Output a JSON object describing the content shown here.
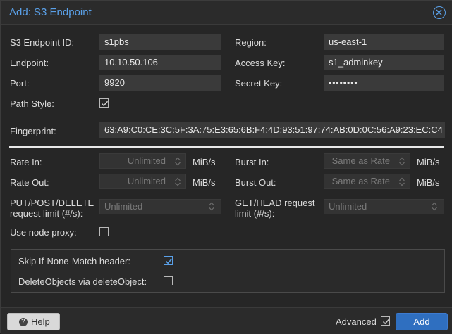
{
  "dialog": {
    "title": "Add: S3 Endpoint"
  },
  "fields": {
    "id": {
      "label": "S3 Endpoint ID:",
      "value": "s1pbs"
    },
    "region": {
      "label": "Region:",
      "value": "us-east-1"
    },
    "endpoint": {
      "label": "Endpoint:",
      "value": "10.10.50.106"
    },
    "access_key": {
      "label": "Access Key:",
      "value": "s1_adminkey"
    },
    "port": {
      "label": "Port:",
      "value": "9920"
    },
    "secret_key": {
      "label": "Secret Key:",
      "value": "••••••••"
    },
    "path_style": {
      "label": "Path Style:",
      "checked": true
    },
    "fingerprint": {
      "label": "Fingerprint:",
      "value": "63:A9:C0:CE:3C:5F:3A:75:E3:65:6B:F4:4D:93:51:97:74:AB:0D:0C:56:A9:23:EC:C4"
    }
  },
  "rates": {
    "rate_in": {
      "label": "Rate In:",
      "placeholder": "Unlimited",
      "unit": "MiB/s"
    },
    "rate_out": {
      "label": "Rate Out:",
      "placeholder": "Unlimited",
      "unit": "MiB/s"
    },
    "burst_in": {
      "label": "Burst In:",
      "placeholder": "Same as Rate",
      "unit": "MiB/s"
    },
    "burst_out": {
      "label": "Burst Out:",
      "placeholder": "Same as Rate",
      "unit": "MiB/s"
    },
    "put_limit": {
      "label": "PUT/POST/DELETE request limit (#/s):",
      "placeholder": "Unlimited"
    },
    "get_limit": {
      "label": "GET/HEAD request limit (#/s):",
      "placeholder": "Unlimited"
    },
    "node_proxy": {
      "label": "Use node proxy:",
      "checked": false
    }
  },
  "advanced": {
    "skip_if_none_match": {
      "label": "Skip If-None-Match header:",
      "checked": true
    },
    "delete_objects": {
      "label": "DeleteObjects via deleteObject:",
      "checked": false
    }
  },
  "footer": {
    "help_label": "Help",
    "advanced_label": "Advanced",
    "advanced_checked": true,
    "add_label": "Add"
  },
  "colors": {
    "accent": "#5aa0e8",
    "primary_button": "#2f6fc0",
    "background": "#262626",
    "field": "#3a3a3a"
  },
  "icons": {
    "close": "close-circle-icon",
    "help": "question-circle-icon",
    "check": "checkmark-icon",
    "spinner": "spinner-arrows-icon",
    "dropdown": "chevron-down-icon"
  }
}
